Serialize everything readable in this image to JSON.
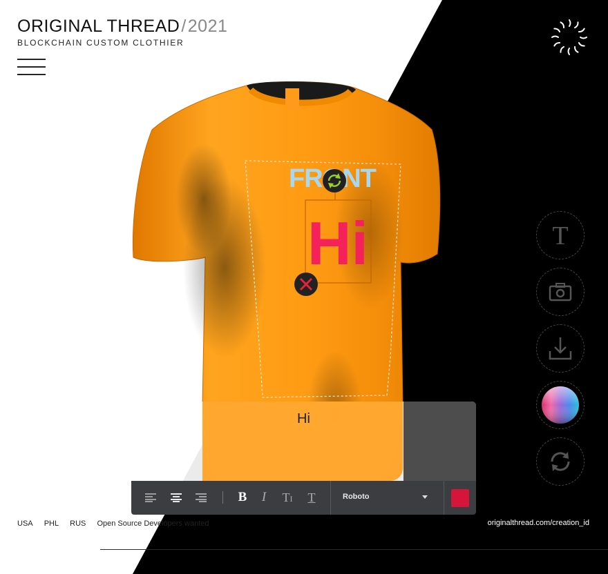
{
  "brand": {
    "title": "ORIGINAL THREAD",
    "slash": "/",
    "year": "2021",
    "subtitle": "BLOCKCHAIN CUSTOM CLOTHIER"
  },
  "colors": {
    "shirt": "#ff9f1a",
    "front_text": "#a8d8f0",
    "hi_text": "#f5215a",
    "swatch": "#d7153a",
    "toolbar": "#3c3d40",
    "rotate_handle": "#9bd02f",
    "delete_handle": "#e3253a"
  },
  "shirt": {
    "print_label": "FRONT",
    "custom_text": "Hi"
  },
  "tools": [
    {
      "name": "text",
      "icon": "text-T-icon"
    },
    {
      "name": "photo",
      "icon": "camera-icon"
    },
    {
      "name": "download",
      "icon": "download-icon"
    },
    {
      "name": "color-palette",
      "icon": "color-wheel-icon"
    },
    {
      "name": "rotate",
      "icon": "refresh-icon"
    }
  ],
  "editor": {
    "text_value": "Hi",
    "font": "Roboto",
    "toolbar": [
      "align-left",
      "align-center",
      "align-right",
      "bold",
      "italic",
      "text-height",
      "text-strike"
    ]
  },
  "footer": {
    "links": [
      "USA",
      "PHL",
      "RUS",
      "Open Source Developers wanted"
    ],
    "url": "originalthread.com/creation_id"
  }
}
